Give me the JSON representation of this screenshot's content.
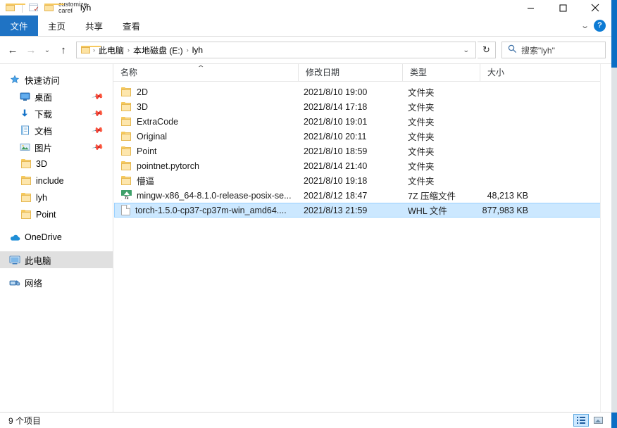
{
  "window": {
    "title": "lyh",
    "quick_access": [
      "folder-icon",
      "properties-icon",
      "new-folder-icon",
      "customize-caret"
    ],
    "controls": {
      "minimize": "—",
      "maximize": "▢",
      "close": "✕"
    }
  },
  "ribbon": {
    "tabs": [
      {
        "label": "文件",
        "active": true
      },
      {
        "label": "主页",
        "active": false
      },
      {
        "label": "共享",
        "active": false
      },
      {
        "label": "查看",
        "active": false
      }
    ],
    "help_label": "?",
    "expand_label": "⌄"
  },
  "address": {
    "back": "←",
    "forward": "→",
    "recent": "⌄",
    "up": "↑",
    "crumbs": [
      "此电脑",
      "本地磁盘 (E:)",
      "lyh"
    ],
    "separator": "›",
    "dropdown": "⌄",
    "refresh_label": "↻"
  },
  "search": {
    "icon": "search-icon",
    "placeholder": "搜索\"lyh\""
  },
  "sidebar": {
    "items": [
      {
        "label": "快速访问",
        "icon": "star-icon",
        "indent": 0,
        "pinned": false,
        "selected": false
      },
      {
        "label": "桌面",
        "icon": "desktop-icon",
        "indent": 1,
        "pinned": true,
        "selected": false
      },
      {
        "label": "下载",
        "icon": "download-icon",
        "indent": 1,
        "pinned": true,
        "selected": false
      },
      {
        "label": "文档",
        "icon": "document-icon",
        "indent": 1,
        "pinned": true,
        "selected": false
      },
      {
        "label": "图片",
        "icon": "pictures-icon",
        "indent": 1,
        "pinned": true,
        "selected": false
      },
      {
        "label": "3D",
        "icon": "folder-icon",
        "indent": 1,
        "pinned": false,
        "selected": false
      },
      {
        "label": "include",
        "icon": "folder-icon",
        "indent": 1,
        "pinned": false,
        "selected": false
      },
      {
        "label": "lyh",
        "icon": "folder-icon",
        "indent": 1,
        "pinned": false,
        "selected": false
      },
      {
        "label": "Point",
        "icon": "folder-icon",
        "indent": 1,
        "pinned": false,
        "selected": false
      },
      {
        "label": "OneDrive",
        "icon": "cloud-icon",
        "indent": 0,
        "pinned": false,
        "selected": false
      },
      {
        "label": "此电脑",
        "icon": "computer-icon",
        "indent": 0,
        "pinned": false,
        "selected": true
      },
      {
        "label": "网络",
        "icon": "network-icon",
        "indent": 0,
        "pinned": false,
        "selected": false
      }
    ]
  },
  "file_list": {
    "columns": [
      {
        "label": "名称",
        "sorted": "asc"
      },
      {
        "label": "修改日期",
        "sorted": ""
      },
      {
        "label": "类型",
        "sorted": ""
      },
      {
        "label": "大小",
        "sorted": ""
      }
    ],
    "rows": [
      {
        "name": "2D",
        "date": "2021/8/10 19:00",
        "type": "文件夹",
        "size": "",
        "icon": "folder-icon",
        "selected": false
      },
      {
        "name": "3D",
        "date": "2021/8/14 17:18",
        "type": "文件夹",
        "size": "",
        "icon": "folder-icon",
        "selected": false
      },
      {
        "name": "ExtraCode",
        "date": "2021/8/10 19:01",
        "type": "文件夹",
        "size": "",
        "icon": "folder-icon",
        "selected": false
      },
      {
        "name": "Original",
        "date": "2021/8/10 20:11",
        "type": "文件夹",
        "size": "",
        "icon": "folder-icon",
        "selected": false
      },
      {
        "name": "Point",
        "date": "2021/8/10 18:59",
        "type": "文件夹",
        "size": "",
        "icon": "folder-icon",
        "selected": false
      },
      {
        "name": "pointnet.pytorch",
        "date": "2021/8/14 21:40",
        "type": "文件夹",
        "size": "",
        "icon": "folder-icon",
        "selected": false
      },
      {
        "name": "懵逼",
        "date": "2021/8/10 19:18",
        "type": "文件夹",
        "size": "",
        "icon": "folder-icon",
        "selected": false
      },
      {
        "name": "mingw-x86_64-8.1.0-release-posix-se...",
        "date": "2021/8/12 18:47",
        "type": "7Z 压缩文件",
        "size": "48,213 KB",
        "icon": "sevenzip-icon",
        "selected": false
      },
      {
        "name": "torch-1.5.0-cp37-cp37m-win_amd64....",
        "date": "2021/8/13 21:59",
        "type": "WHL 文件",
        "size": "877,983 KB",
        "icon": "file-icon",
        "selected": true
      }
    ]
  },
  "status": {
    "item_count": "9 个项目",
    "views": [
      {
        "name": "details-view",
        "active": true
      },
      {
        "name": "large-icons-view",
        "active": false
      }
    ]
  },
  "colors": {
    "accent": "#1f73c4",
    "selection": "#cce8ff",
    "selection_border": "#99d1ff",
    "folder": "#fcd884",
    "sevenzip": "#2e8b57",
    "desktop": "#0b6ec4"
  }
}
